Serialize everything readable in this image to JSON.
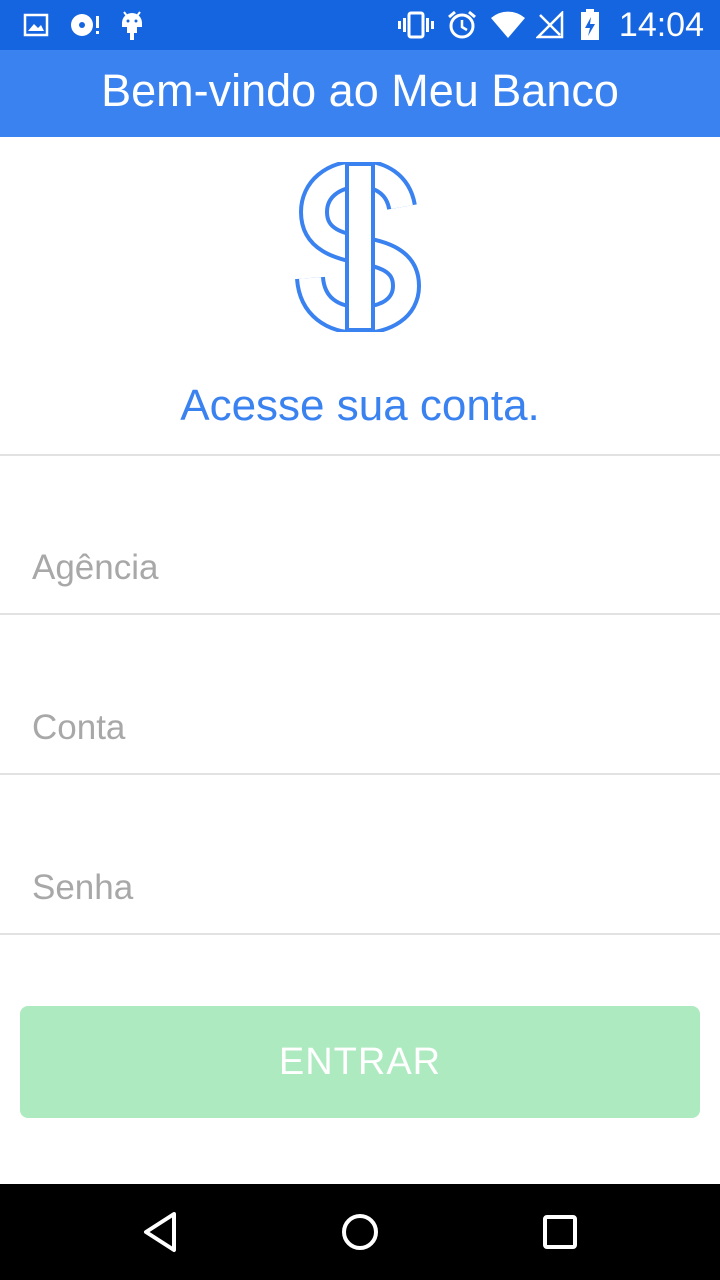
{
  "status_bar": {
    "time": "14:04",
    "icons": [
      "image-icon",
      "disc-icon",
      "android-icon",
      "vibrate-icon",
      "alarm-icon",
      "wifi-icon",
      "no-signal-icon",
      "battery-icon"
    ]
  },
  "app_bar": {
    "title": "Bem-vindo ao Meu Banco"
  },
  "logo": {
    "icon": "dollar-sign-icon",
    "color": "#3a82f0"
  },
  "heading": "Acesse sua conta.",
  "form": {
    "agencia_placeholder": "Agência",
    "conta_placeholder": "Conta",
    "senha_placeholder": "Senha",
    "submit_label": "ENTRAR"
  },
  "colors": {
    "status_bar": "#1565e0",
    "app_bar": "#3a82f0",
    "button": "#aeeac0"
  },
  "nav_bar": {
    "icons": [
      "back-icon",
      "home-icon",
      "recents-icon"
    ]
  }
}
